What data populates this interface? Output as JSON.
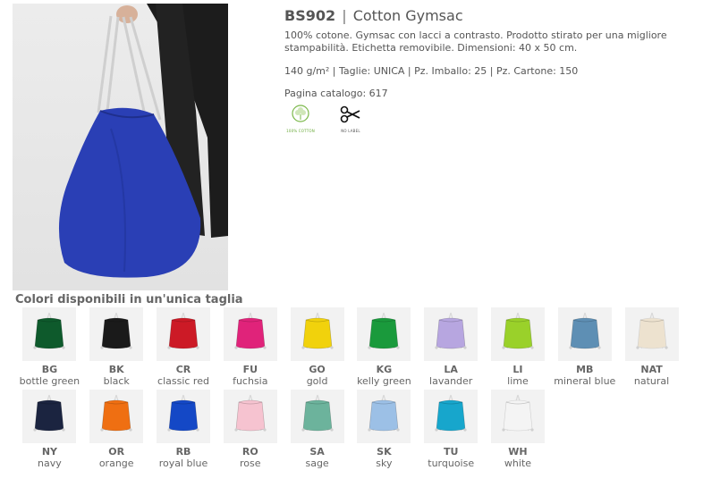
{
  "product": {
    "code": "BS902",
    "separator": "|",
    "name": "Cotton Gymsac",
    "description": "100% cotone. Gymsac con lacci a contrasto. Prodotto stirato per una migliore stampabilità. Etichetta removibile. Dimensioni: 40 x 50 cm.",
    "specs": "140 g/m² | Taglie: UNICA | Pz. Imballo: 25 | Pz. Cartone: 150",
    "catalog": "Pagina catalogo: 617",
    "photo_bag_color": "#2a3fb5"
  },
  "badges": [
    {
      "icon": "cotton-icon",
      "caption": "100% COTTON"
    },
    {
      "icon": "scissors-icon",
      "caption": "NO LABEL"
    }
  ],
  "colors_title": "Colori disponibili in un'unica taglia",
  "colors": [
    {
      "code": "BG",
      "name": "bottle green",
      "hex": "#0e5a2c"
    },
    {
      "code": "BK",
      "name": "black",
      "hex": "#1a1a1a"
    },
    {
      "code": "CR",
      "name": "classic red",
      "hex": "#cc1a26"
    },
    {
      "code": "FU",
      "name": "fuchsia",
      "hex": "#e0237a"
    },
    {
      "code": "GO",
      "name": "gold",
      "hex": "#f1d20c"
    },
    {
      "code": "KG",
      "name": "kelly green",
      "hex": "#1a9a3c"
    },
    {
      "code": "LA",
      "name": "lavander",
      "hex": "#b7a6e0"
    },
    {
      "code": "LI",
      "name": "lime",
      "hex": "#9ad12a"
    },
    {
      "code": "MB",
      "name": "mineral blue",
      "hex": "#5e8fb4"
    },
    {
      "code": "NAT",
      "name": "natural",
      "hex": "#ede2cf"
    },
    {
      "code": "NY",
      "name": "navy",
      "hex": "#1b2440"
    },
    {
      "code": "OR",
      "name": "orange",
      "hex": "#ef6f12"
    },
    {
      "code": "RB",
      "name": "royal blue",
      "hex": "#1448c6"
    },
    {
      "code": "RO",
      "name": "rose",
      "hex": "#f6c3d0"
    },
    {
      "code": "SA",
      "name": "sage",
      "hex": "#6cb39c"
    },
    {
      "code": "SK",
      "name": "sky",
      "hex": "#9cc0e6"
    },
    {
      "code": "TU",
      "name": "turquoise",
      "hex": "#17a6cc"
    },
    {
      "code": "WH",
      "name": "white",
      "hex": "#f4f4f4"
    }
  ]
}
